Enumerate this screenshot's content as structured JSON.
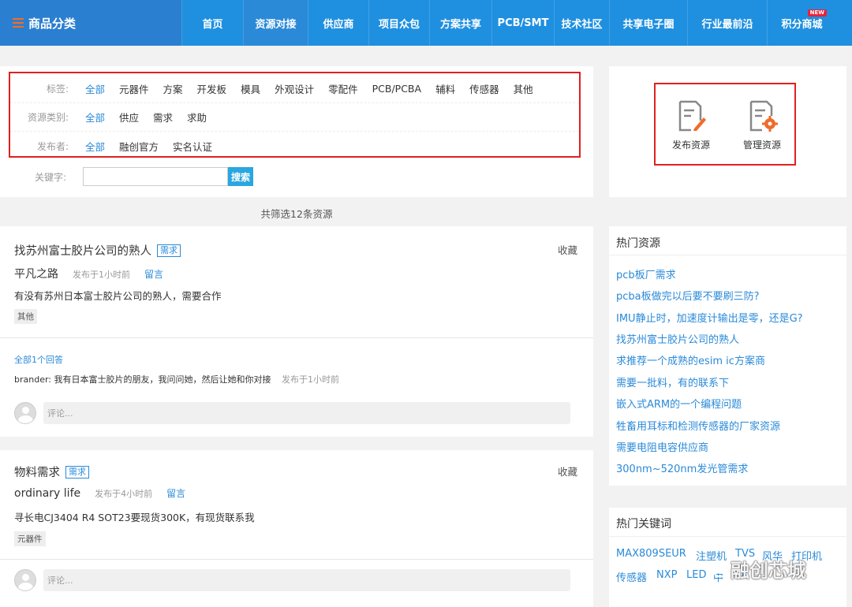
{
  "nav": {
    "brand": "商品分类",
    "items": [
      {
        "label": "首页",
        "active": false
      },
      {
        "label": "资源对接",
        "active": true
      },
      {
        "label": "供应商",
        "active": false
      },
      {
        "label": "项目众包",
        "active": false
      },
      {
        "label": "方案共享",
        "active": false
      },
      {
        "label": "PCB/SMT",
        "active": false
      },
      {
        "label": "技术社区",
        "active": false
      },
      {
        "label": "共享电子圈",
        "active": false
      },
      {
        "label": "行业最前沿",
        "active": false
      },
      {
        "label": "积分商城",
        "active": false,
        "badge": "NEW"
      }
    ]
  },
  "filters": {
    "tags": {
      "label": "标签:",
      "items": [
        "全部",
        "元器件",
        "方案",
        "开发板",
        "模具",
        "外观设计",
        "零配件",
        "PCB/PCBA",
        "辅料",
        "传感器",
        "其他"
      ]
    },
    "types": {
      "label": "资源类别:",
      "items": [
        "全部",
        "供应",
        "需求",
        "求助"
      ]
    },
    "publishers": {
      "label": "发布者:",
      "items": [
        "全部",
        "融创官方",
        "实名认证"
      ]
    },
    "keyword": {
      "label": "关键字:",
      "value": "",
      "button": "搜索"
    }
  },
  "result_count": "共筛选12条资源",
  "posts": [
    {
      "title": "找苏州富士胶片公司的熟人",
      "type_tag": "需求",
      "favorite": "收藏",
      "author": "平凡之路",
      "posted": "发布于1小时前",
      "reply": "留言",
      "description": "有没有苏州日本富士胶片公司的熟人，需要合作",
      "category": "其他",
      "answers_link": "全部1个回答",
      "answer": {
        "user": "brander:",
        "text": "我有日本富士胶片的朋友，我问问她，然后让她和你对接",
        "time": "发布于1小时前"
      },
      "comment_placeholder": "评论..."
    },
    {
      "title": "物料需求",
      "type_tag": "需求",
      "favorite": "收藏",
      "author": "ordinary life",
      "posted": "发布于4小时前",
      "reply": "留言",
      "description": "寻长电CJ3404 R4 SOT23要现货300K，有现货联系我",
      "category": "元器件",
      "comment_placeholder": "评论..."
    }
  ],
  "publish": {
    "publish_label": "发布资源",
    "manage_label": "管理资源"
  },
  "hot_resources": {
    "title": "热门资源",
    "items": [
      "pcb板厂需求",
      "pcba板做完以后要不要刷三防?",
      "IMU静止时，加速度计输出是零，还是G?",
      "找苏州富士胶片公司的熟人",
      "求推荐一个成熟的esim ic方案商",
      "需要一批料，有的联系下",
      "嵌入式ARM的一个编程问题",
      "牲畜用耳标和检测传感器的厂家资源",
      "需要电阻电容供应商",
      "300nm~520nm发光管需求"
    ]
  },
  "hot_keywords": {
    "title": "热门关键词",
    "items": [
      "MAX809SEUR",
      "注塑机",
      "TVS",
      "风华",
      "打印机",
      "传感器",
      "NXP",
      "LED",
      "中",
      "e"
    ]
  },
  "watermark": "融创芯城",
  "colors": {
    "nav": "#1f90e0",
    "accent": "#2a8ad8",
    "highlight_border": "#e02020"
  }
}
